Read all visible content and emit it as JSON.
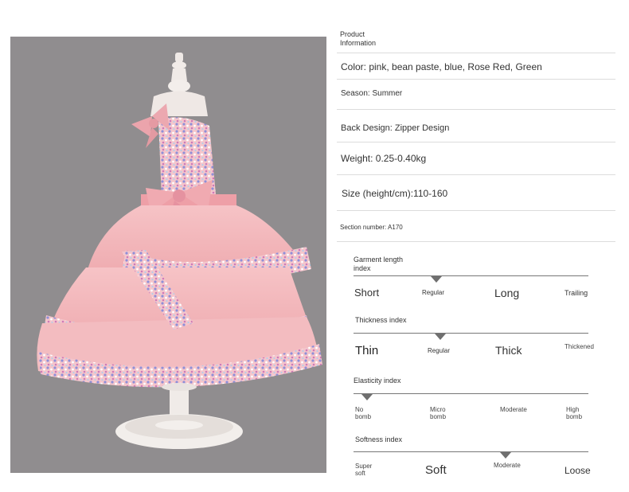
{
  "header": {
    "title": "Product Information"
  },
  "specs": {
    "color": "Color: pink, bean paste, blue, Rose Red, Green",
    "season": "Season: Summer",
    "back_design": "Back Design: Zipper Design",
    "weight": "Weight: 0.25-0.40kg",
    "size": "Size (height/cm):110-160",
    "section_number": "Section number: A170"
  },
  "indices": {
    "garment_length": {
      "title": "Garment length index",
      "labels": [
        "Short",
        "Regular",
        "Long",
        "Trailing"
      ],
      "selected": "Regular"
    },
    "thickness": {
      "title": "Thickness index",
      "labels": [
        "Thin",
        "Regular",
        "Thick",
        "Thickened"
      ],
      "selected": "Regular"
    },
    "elasticity": {
      "title": "Elasticity index",
      "labels": [
        "No bomb",
        "Micro bomb",
        "Moderate",
        "High bomb"
      ],
      "selected": "No bomb"
    },
    "softness": {
      "title": "Softness index",
      "labels": [
        "Super soft",
        "Soft",
        "Moderate",
        "Loose"
      ],
      "selected": "Moderate"
    }
  },
  "colors": {
    "background": "#ffffff",
    "photo_bg": "#908d8f",
    "dress_pink": "#f2b5b8",
    "marker": "#6f6f6f"
  }
}
